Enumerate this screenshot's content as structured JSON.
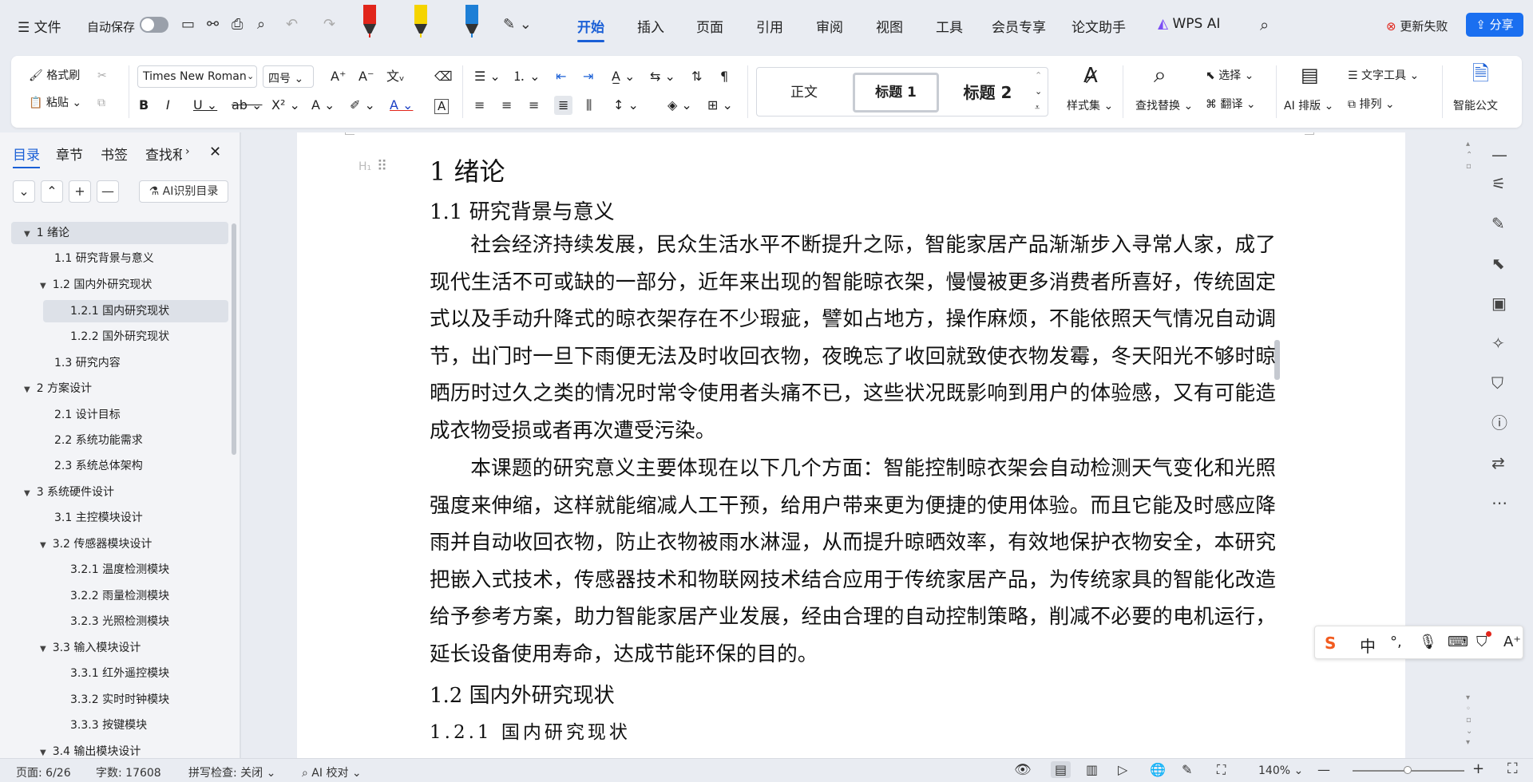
{
  "menubar": {
    "file_label": "文件",
    "autosave_label": "自动保存",
    "menus": [
      "开始",
      "插入",
      "页面",
      "引用",
      "审阅",
      "视图",
      "工具",
      "会员专享",
      "论文助手",
      "WPS AI"
    ],
    "update_fail_label": "更新失败",
    "share_label": "分享"
  },
  "ribbon": {
    "format_brush": "格式刷",
    "paste": "粘贴",
    "font_name": "Times New Roman",
    "font_size": "四号",
    "styles": [
      "正文",
      "标题 1",
      "标题 2"
    ],
    "style_set": "样式集",
    "find_replace": "查找替换",
    "select": "选择",
    "translate": "翻译",
    "ai_layout": "AI 排版",
    "text_tools": "文字工具",
    "arrange": "排列",
    "smart_doc": "智能公文"
  },
  "sidebar": {
    "tabs": [
      "目录",
      "章节",
      "书签",
      "查找和"
    ],
    "ai_toc_label": "AI识别目录",
    "toc": [
      {
        "label": "1  绪论"
      },
      {
        "label": "1.1  研究背景与意义"
      },
      {
        "label": "1.2  国内外研究现状"
      },
      {
        "label": "1.2.1  国内研究现状"
      },
      {
        "label": "1.2.2  国外研究现状"
      },
      {
        "label": "1.3  研究内容"
      },
      {
        "label": "2  方案设计"
      },
      {
        "label": "2.1  设计目标"
      },
      {
        "label": "2.2  系统功能需求"
      },
      {
        "label": "2.3  系统总体架构"
      },
      {
        "label": "3  系统硬件设计"
      },
      {
        "label": "3.1  主控模块设计"
      },
      {
        "label": "3.2  传感器模块设计"
      },
      {
        "label": "3.2.1  温度检测模块"
      },
      {
        "label": "3.2.2  雨量检测模块"
      },
      {
        "label": "3.2.3  光照检测模块"
      },
      {
        "label": "3.3  输入模块设计"
      },
      {
        "label": "3.3.1  红外遥控模块"
      },
      {
        "label": "3.3.2  实时时钟模块"
      },
      {
        "label": "3.3.3  按键模块"
      },
      {
        "label": "3.4  输出模块设计"
      }
    ]
  },
  "document": {
    "h1": "1  绪论",
    "h2_a": "1.1  研究背景与意义",
    "p1": "社会经济持续发展，民众生活水平不断提升之际，智能家居产品渐渐步入寻常人家，成了现代生活不可或缺的一部分，近年来出现的智能晾衣架，慢慢被更多消费者所喜好，传统固定式以及手动升降式的晾衣架存在不少瑕疵，譬如占地方，操作麻烦，不能依照天气情况自动调节，出门时一旦下雨便无法及时收回衣物，夜晚忘了收回就致使衣物发霉，冬天阳光不够时晾晒历时过久之类的情况时常令使用者头痛不已，这些状况既影响到用户的体验感，又有可能造成衣物受损或者再次遭受污染。",
    "p2": "本课题的研究意义主要体现在以下几个方面：智能控制晾衣架会自动检测天气变化和光照强度来伸缩，这样就能缩减人工干预，给用户带来更为便捷的使用体验。而且它能及时感应降雨并自动收回衣物，防止衣物被雨水淋湿，从而提升晾晒效率，有效地保护衣物安全，本研究把嵌入式技术，传感器技术和物联网技术结合应用于传统家居产品，为传统家具的智能化改造给予参考方案，助力智能家居产业发展，经由合理的自动控制策略，削减不必要的电机运行，延长设备使用寿命，达成节能环保的目的。",
    "h2_b": "1.2  国内外研究现状",
    "h3": "1.2.1  国内研究现状"
  },
  "ime": {
    "lang": "中"
  },
  "status": {
    "page": "页面: 6/26",
    "words": "字数: 17608",
    "spell": "拼写检查: 关闭",
    "ai_check": "AI 校对",
    "zoom": "140%"
  }
}
